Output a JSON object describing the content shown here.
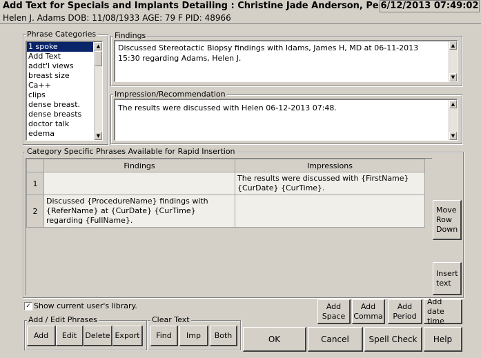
{
  "window": {
    "title": "Add Text for Specials and Implants Detailing   : Christine Jade Anderson, Penrad Main",
    "clock": "6/12/2013 07:49:02"
  },
  "patient": {
    "info": "Helen J. Adams   DOB: 11/08/1933   AGE: 79   F   PID: 48966"
  },
  "phrase_categories": {
    "label": "Phrase Categories",
    "items": [
      "1 spoke",
      "Add Text",
      "addt'l views",
      "breast size",
      "Ca++",
      "clips",
      "dense breast.",
      "dense breasts",
      "doctor talk",
      "edema"
    ]
  },
  "findings": {
    "label": "Findings",
    "text": "Discussed Stereotactic Biopsy findings with Idams, James H, MD at 06-11-2013 15:30 regarding Adams, Helen J."
  },
  "impression": {
    "label": "Impression/Recommendation",
    "text": "The results were discussed with Helen 06-12-2013 07:48."
  },
  "phrases": {
    "label": "Category Specific Phrases Available for Rapid Insertion",
    "columns": [
      "Findings",
      "Impressions"
    ],
    "rows": [
      {
        "num": "1",
        "findings": "",
        "impressions": "The results were discussed with {FirstName} {CurDate} {CurTime}."
      },
      {
        "num": "2",
        "findings": "Discussed {ProcedureName} findings with {ReferName} at {CurDate} {CurTime} regarding {FullName}.",
        "impressions": ""
      }
    ],
    "move_row_down": "Move Row Down",
    "insert_text": "Insert text"
  },
  "library": {
    "checkbox_label": "Show current user's library.",
    "checked": true,
    "check_mark": "✓"
  },
  "add_edit": {
    "label": "Add / Edit Phrases",
    "add": "Add",
    "edit": "Edit",
    "delete": "Delete",
    "export": "Export"
  },
  "clear_text": {
    "label": "Clear Text",
    "find": "Find",
    "imp": "Imp",
    "both": "Both"
  },
  "insert_buttons": {
    "add_space": "Add Space",
    "add_comma": "Add Comma",
    "add_period": "Add Period",
    "add_date_time": "Add date time"
  },
  "footer": {
    "ok": "OK",
    "cancel": "Cancel",
    "spell_check": "Spell Check",
    "help": "Help"
  },
  "scroll_glyphs": {
    "up": "▲",
    "down": "▼"
  }
}
